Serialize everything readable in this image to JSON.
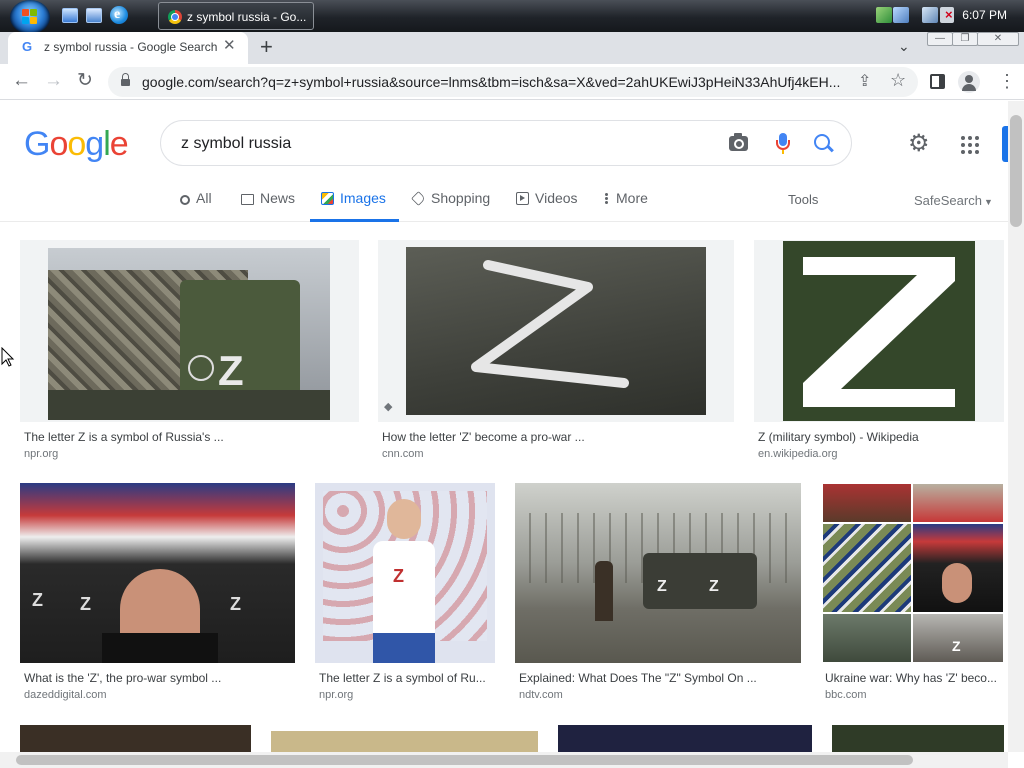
{
  "taskbar": {
    "task_title": "z symbol russia - Go...",
    "clock": "6:07 PM",
    "quicklaunch": [
      "desktop-icon",
      "explorer-icon",
      "internet-explorer-icon"
    ],
    "tray": [
      "network-icon",
      "network-icon",
      "volume-muted-icon"
    ]
  },
  "browser": {
    "tab_title": "z symbol russia - Google Search",
    "tab_close": "✕",
    "new_tab": "+",
    "tab_menu": "⌄",
    "url": "google.com/search?q=z+symbol+russia&source=lnms&tbm=isch&sa=X&ved=2ahUKEwiJ3pHeiN33AhUfj4kEH...",
    "back": "←",
    "forward": "→",
    "reload": "↻",
    "window_buttons": [
      "—",
      "❐",
      "✕"
    ]
  },
  "google": {
    "logo_letters": [
      {
        "ch": "G",
        "color": "#4285f4"
      },
      {
        "ch": "o",
        "color": "#ea4335"
      },
      {
        "ch": "o",
        "color": "#fbbc05"
      },
      {
        "ch": "g",
        "color": "#4285f4"
      },
      {
        "ch": "l",
        "color": "#34a853"
      },
      {
        "ch": "e",
        "color": "#ea4335"
      }
    ],
    "query": "z symbol russia",
    "tabs": [
      {
        "label": "All",
        "icon": "search-icon"
      },
      {
        "label": "News",
        "icon": "news-icon"
      },
      {
        "label": "Images",
        "icon": "images-icon",
        "active": true
      },
      {
        "label": "Shopping",
        "icon": "shopping-tag-icon"
      },
      {
        "label": "Videos",
        "icon": "video-play-icon"
      },
      {
        "label": "More",
        "icon": "more-dots-icon"
      }
    ],
    "tools": "Tools",
    "safesearch": "SafeSearch"
  },
  "results": [
    {
      "title": "The letter Z is a symbol of Russia's ...",
      "site": "npr.org",
      "thumb": "military-truck-z"
    },
    {
      "title": "How the letter 'Z' become a pro-war ...",
      "site": "cnn.com",
      "thumb": "tarp-z"
    },
    {
      "title": "Z (military symbol) - Wikipedia",
      "site": "en.wikipedia.org",
      "thumb": "green-z"
    },
    {
      "title": "What is the 'Z', the pro-war symbol ...",
      "site": "dazeddigital.com",
      "thumb": "crowd-z-shirts"
    },
    {
      "title": "The letter Z is a symbol of Ru...",
      "site": "npr.org",
      "thumb": "gymnast-z"
    },
    {
      "title": "Explained: What Does The \"Z\" Symbol On ...",
      "site": "ndtv.com",
      "thumb": "tank-z"
    },
    {
      "title": "Ukraine war: Why has 'Z' beco...",
      "site": "bbc.com",
      "thumb": "collage-z"
    }
  ],
  "colors": {
    "accent": "#1a73e8",
    "text": "#3c4043",
    "muted": "#70757a"
  }
}
